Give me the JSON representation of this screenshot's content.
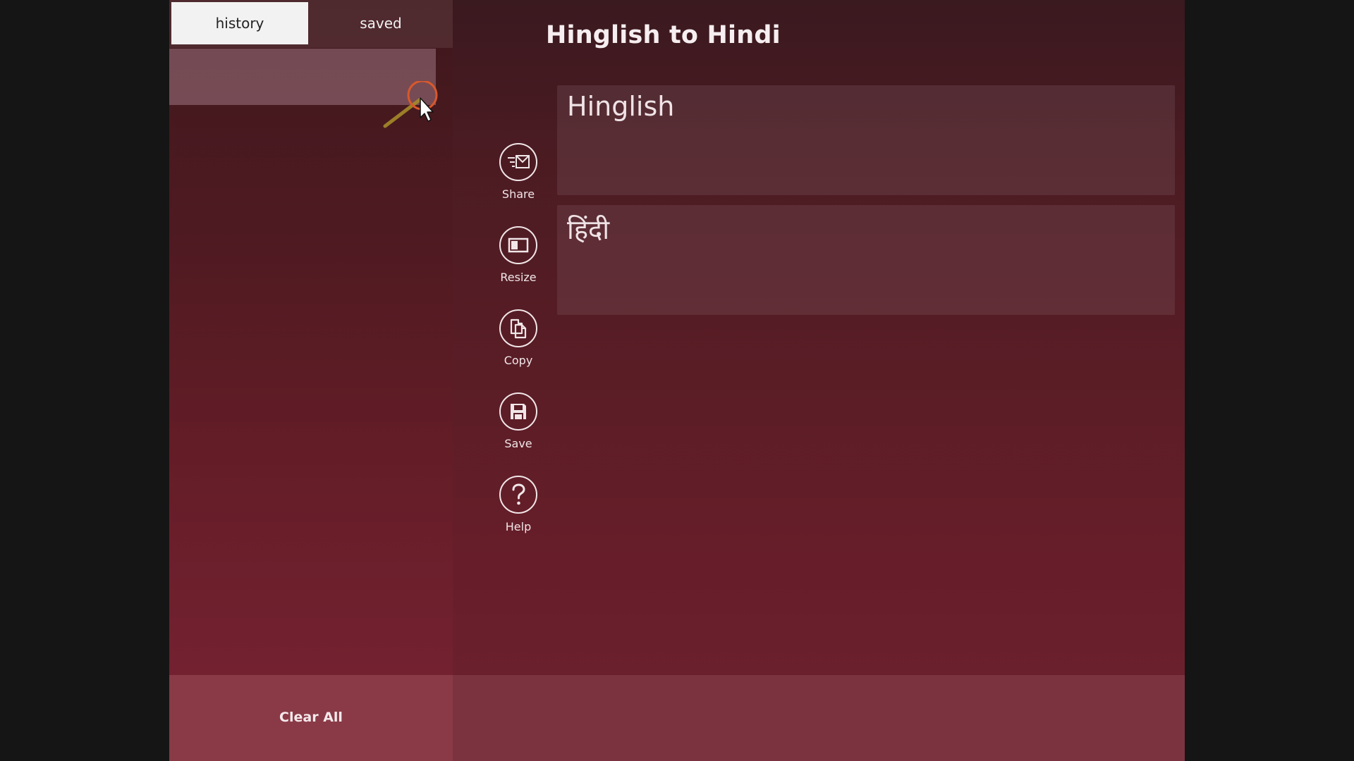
{
  "tabs": {
    "history_label": "history",
    "saved_label": "saved"
  },
  "sidebar": {
    "clear_all_label": "Clear All"
  },
  "header": {
    "title": "Hinglish to Hindi"
  },
  "tools": [
    {
      "label": "Share",
      "icon": "share-mail-icon"
    },
    {
      "label": "Resize",
      "icon": "resize-icon"
    },
    {
      "label": "Copy",
      "icon": "copy-icon"
    },
    {
      "label": "Save",
      "icon": "save-disk-icon"
    },
    {
      "label": "Help",
      "icon": "help-question-icon"
    }
  ],
  "translator": {
    "source_placeholder": "Hinglish",
    "target_placeholder": "हिंदी"
  },
  "colors": {
    "background_top": "#3a191f",
    "background_bottom": "#6e2130",
    "bottom_bar": "#8a3a47",
    "active_tab": "#f2f2f2",
    "cursor_ring": "#d9582b",
    "cursor_trail": "#a58a2a"
  }
}
